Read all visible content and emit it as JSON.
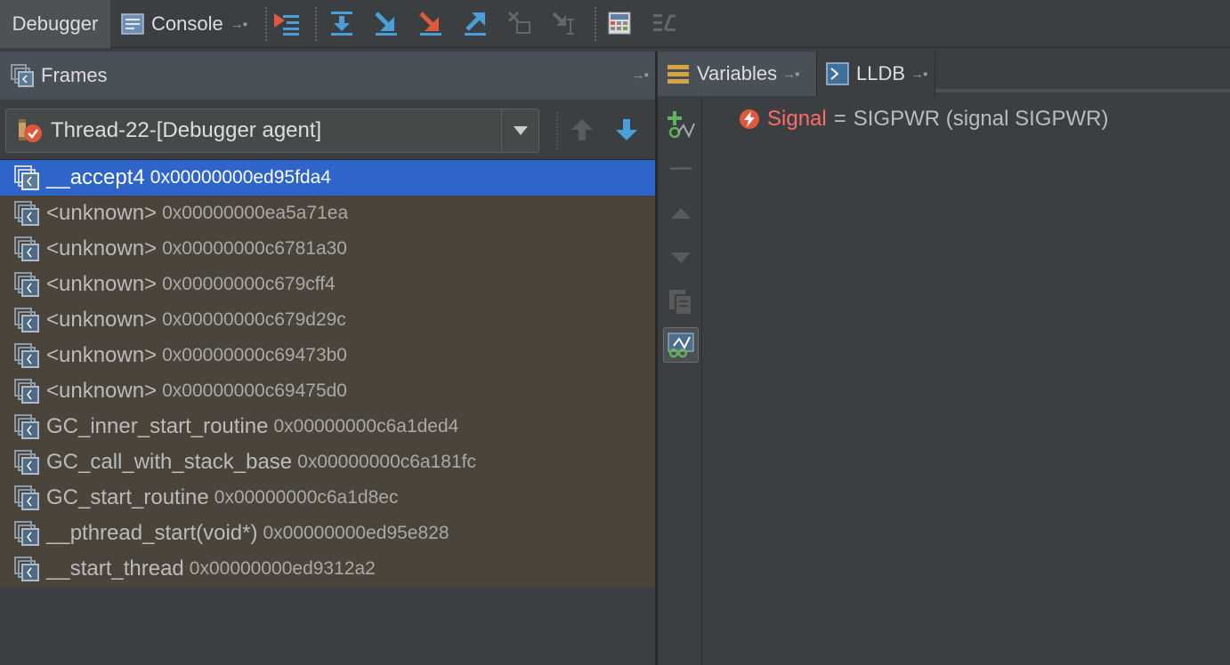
{
  "toolbar": {
    "debugger_tab": "Debugger",
    "console_tab": "Console"
  },
  "frames": {
    "header": "Frames",
    "thread": "Thread-22-[Debugger agent]",
    "rows": [
      {
        "name": "__accept4",
        "addr": "0x00000000ed95fda4"
      },
      {
        "name": "<unknown>",
        "addr": "0x00000000ea5a71ea"
      },
      {
        "name": "<unknown>",
        "addr": "0x00000000c6781a30"
      },
      {
        "name": "<unknown>",
        "addr": "0x00000000c679cff4"
      },
      {
        "name": "<unknown>",
        "addr": "0x00000000c679d29c"
      },
      {
        "name": "<unknown>",
        "addr": "0x00000000c69473b0"
      },
      {
        "name": "<unknown>",
        "addr": "0x00000000c69475d0"
      },
      {
        "name": "GC_inner_start_routine",
        "addr": "0x00000000c6a1ded4"
      },
      {
        "name": "GC_call_with_stack_base",
        "addr": "0x00000000c6a181fc"
      },
      {
        "name": "GC_start_routine",
        "addr": "0x00000000c6a1d8ec"
      },
      {
        "name": "__pthread_start(void*)",
        "addr": "0x00000000ed95e828"
      },
      {
        "name": "__start_thread",
        "addr": "0x00000000ed9312a2"
      }
    ]
  },
  "variables": {
    "tab_variables": "Variables",
    "tab_lldb": "LLDB",
    "item": {
      "name": "Signal",
      "eq": "=",
      "value": "SIGPWR (signal SIGPWR)"
    }
  },
  "colors": {
    "selection": "#2f65ca",
    "frame_bg": "#4a443a",
    "signal_name": "#ff6b68"
  }
}
